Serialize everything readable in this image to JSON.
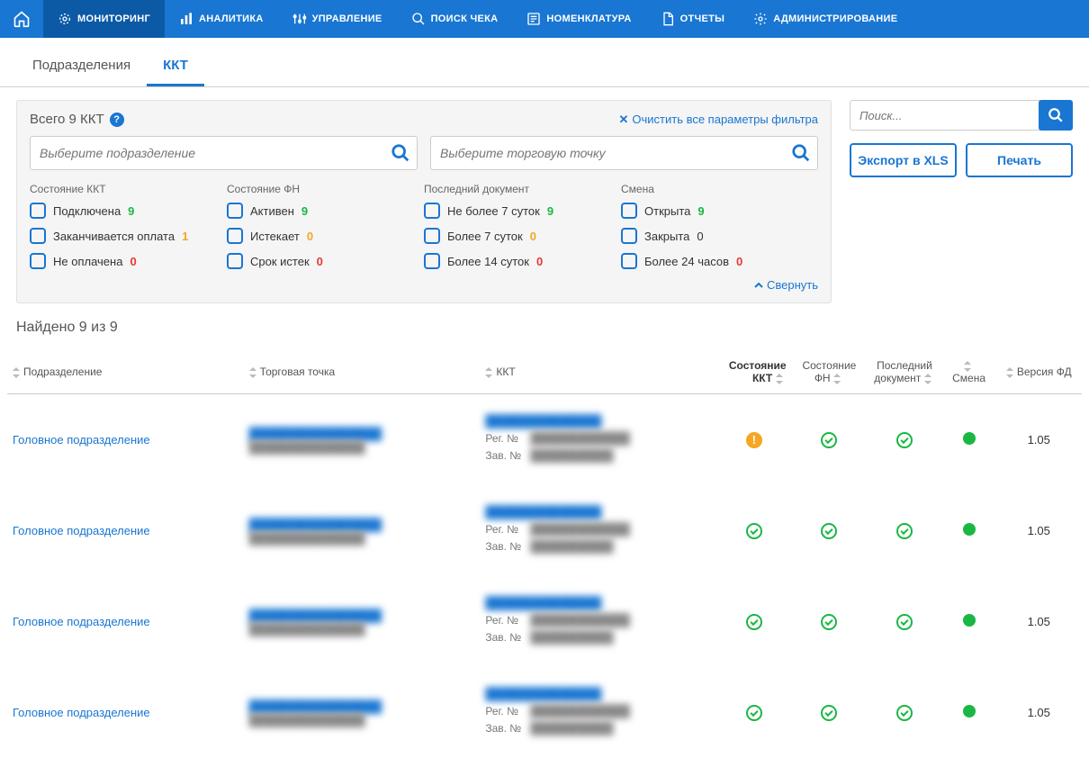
{
  "nav": {
    "items": [
      {
        "label": "МОНИТОРИНГ",
        "active": true
      },
      {
        "label": "АНАЛИТИКА"
      },
      {
        "label": "УПРАВЛЕНИЕ"
      },
      {
        "label": "ПОИСК ЧЕКА"
      },
      {
        "label": "НОМЕНКЛАТУРА"
      },
      {
        "label": "ОТЧЕТЫ"
      },
      {
        "label": "АДМИНИСТРИРОВАНИЕ"
      }
    ]
  },
  "subtabs": {
    "items": [
      {
        "label": "Подразделения"
      },
      {
        "label": "ККТ",
        "active": true
      }
    ]
  },
  "filters": {
    "total_label": "Всего 9 ККТ",
    "clear_label": "Очистить все параметры фильтра",
    "search1_placeholder": "Выберите подразделение",
    "search2_placeholder": "Выберите торговую точку",
    "groups": [
      {
        "title": "Состояние ККТ",
        "opts": [
          {
            "label": "Подключена",
            "count": "9",
            "cls": "cnt-green"
          },
          {
            "label": "Заканчивается оплата",
            "count": "1",
            "cls": "cnt-orange"
          },
          {
            "label": "Не оплачена",
            "count": "0",
            "cls": "cnt-red"
          }
        ]
      },
      {
        "title": "Состояние ФН",
        "opts": [
          {
            "label": "Активен",
            "count": "9",
            "cls": "cnt-green"
          },
          {
            "label": "Истекает",
            "count": "0",
            "cls": "cnt-orange"
          },
          {
            "label": "Срок истек",
            "count": "0",
            "cls": "cnt-red"
          }
        ]
      },
      {
        "title": "Последний документ",
        "opts": [
          {
            "label": "Не более 7 суток",
            "count": "9",
            "cls": "cnt-green"
          },
          {
            "label": "Более 7 суток",
            "count": "0",
            "cls": "cnt-orange"
          },
          {
            "label": "Более 14 суток",
            "count": "0",
            "cls": "cnt-red"
          }
        ]
      },
      {
        "title": "Смена",
        "opts": [
          {
            "label": "Открыта",
            "count": "9",
            "cls": "cnt-green"
          },
          {
            "label": "Закрыта",
            "count": "0",
            "cls": ""
          },
          {
            "label": "Более 24 часов",
            "count": "0",
            "cls": "cnt-red"
          }
        ]
      }
    ],
    "collapse_label": "Свернуть"
  },
  "side": {
    "search_placeholder": "Поиск...",
    "export_label": "Экспорт в XLS",
    "print_label": "Печать"
  },
  "results": {
    "found_label": "Найдено 9 из 9",
    "columns": {
      "dept": "Подразделение",
      "point": "Торговая точка",
      "kkt": "ККТ",
      "kkt_state": "Состояние ККТ",
      "fn_state": "Состояние ФН",
      "last_doc": "Последний документ",
      "shift": "Смена",
      "fd_ver": "Версия ФД"
    },
    "reg_label": "Рег. №",
    "zav_label": "Зав. №",
    "rows": [
      {
        "dept": "Головное подразделение",
        "kkt_state": "warn",
        "fd": "1.05"
      },
      {
        "dept": "Головное подразделение",
        "kkt_state": "ok",
        "fd": "1.05"
      },
      {
        "dept": "Головное подразделение",
        "kkt_state": "ok",
        "fd": "1.05"
      },
      {
        "dept": "Головное подразделение",
        "kkt_state": "ok",
        "fd": "1.05"
      }
    ]
  }
}
